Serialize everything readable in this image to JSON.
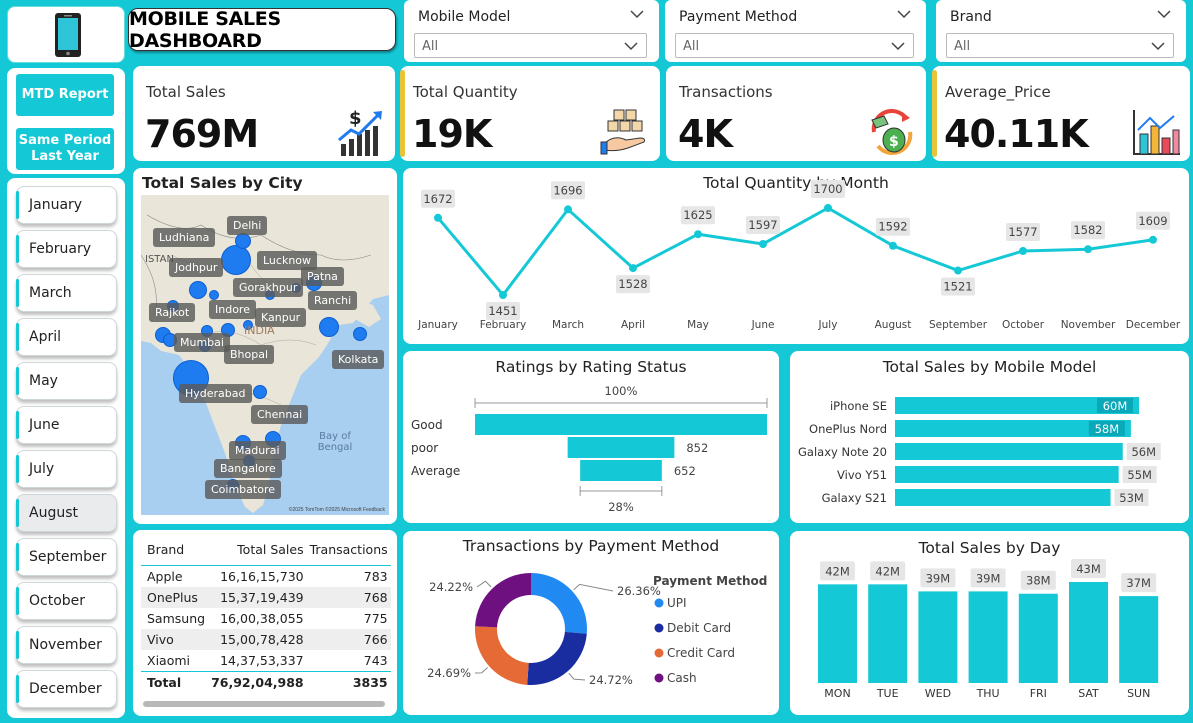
{
  "dashboard": {
    "title": "MOBILE SALES DASHBOARD"
  },
  "slicers": [
    {
      "label": "Mobile Model",
      "value": "All"
    },
    {
      "label": "Payment Method",
      "value": "All"
    },
    {
      "label": "Brand",
      "value": "All"
    }
  ],
  "buttons": {
    "mtd": "MTD Report",
    "same_period": "Same Period Last Year"
  },
  "months": [
    "January",
    "February",
    "March",
    "April",
    "May",
    "June",
    "July",
    "August",
    "September",
    "October",
    "November",
    "December"
  ],
  "selected_month": "August",
  "kpis": [
    {
      "label": "Total Sales",
      "value": "769M",
      "icon": "money-growth-icon"
    },
    {
      "label": "Total Quantity",
      "value": "19K",
      "icon": "boxes-hand-icon"
    },
    {
      "label": "Transactions",
      "value": "4K",
      "icon": "money-bag-exchange-icon"
    },
    {
      "label": "Average_Price",
      "value": "40.11K",
      "icon": "bar-chart-icon"
    }
  ],
  "map": {
    "title": "Total Sales by City",
    "cities": [
      "Delhi",
      "Ludhiana",
      "Lucknow",
      "Jodhpur",
      "Patna",
      "Gorakhpur",
      "Ranchi",
      "Rajkot",
      "Indore",
      "Kanpur",
      "Mumbai",
      "Bhopal",
      "Kolkata",
      "Hyderabad",
      "Chennai",
      "Madurai",
      "Bangalore",
      "Coimbatore"
    ],
    "features": [
      "Bay of Bengal",
      "INDIA",
      "ISTAN"
    ],
    "attribution": "©2025 TomTom ©2025 Microsoft Feedback"
  },
  "brand_table": {
    "headers": [
      "Brand",
      "Total Sales",
      "Transactions"
    ],
    "rows": [
      [
        "Apple",
        "16,16,15,730",
        "783"
      ],
      [
        "OnePlus",
        "15,37,19,439",
        "768"
      ],
      [
        "Samsung",
        "16,00,38,055",
        "775"
      ],
      [
        "Vivo",
        "15,00,78,428",
        "766"
      ],
      [
        "Xiaomi",
        "14,37,53,337",
        "743"
      ]
    ],
    "total": [
      "Total",
      "76,92,04,988",
      "3835"
    ]
  },
  "colors": {
    "accent": "#15c8d6",
    "kpi_accent": "#e8c43a",
    "bubble": "#1e7bf0"
  },
  "chart_data": [
    {
      "type": "line",
      "title": "Total Quantity by Month",
      "categories": [
        "January",
        "February",
        "March",
        "April",
        "May",
        "June",
        "July",
        "August",
        "September",
        "October",
        "November",
        "December"
      ],
      "values": [
        1672,
        1451,
        1696,
        1528,
        1625,
        1597,
        1700,
        1592,
        1521,
        1577,
        1582,
        1609
      ]
    },
    {
      "type": "bar",
      "title": "Ratings by Rating Status",
      "categories": [
        "Good",
        "poor",
        "Average"
      ],
      "values": [
        2331,
        852,
        652
      ],
      "annotations": {
        "top": "100%",
        "bottom": "28%"
      }
    },
    {
      "type": "bar",
      "title": "Total Sales by Mobile Model",
      "categories": [
        "iPhone SE",
        "OnePlus Nord",
        "Galaxy Note 20",
        "Vivo Y51",
        "Galaxy S21"
      ],
      "values": [
        60,
        58,
        56,
        55,
        53
      ],
      "labels": [
        "60M",
        "58M",
        "56M",
        "55M",
        "53M"
      ]
    },
    {
      "type": "pie",
      "title": "Transactions by Payment Method",
      "legend_title": "Payment Method",
      "categories": [
        "UPI",
        "Debit Card",
        "Credit Card",
        "Cash"
      ],
      "values": [
        26.36,
        24.72,
        24.69,
        24.22
      ],
      "labels": [
        "26.36%",
        "24.72%",
        "24.69%",
        "24.22%"
      ],
      "colors": [
        "#2089f2",
        "#1a2da0",
        "#e56a35",
        "#6e1080"
      ]
    },
    {
      "type": "bar",
      "title": "Total Sales by Day",
      "categories": [
        "MON",
        "TUE",
        "WED",
        "THU",
        "FRI",
        "SAT",
        "SUN"
      ],
      "values": [
        42,
        42,
        39,
        39,
        38,
        43,
        37
      ],
      "labels": [
        "42M",
        "42M",
        "39M",
        "39M",
        "38M",
        "43M",
        "37M"
      ]
    }
  ]
}
